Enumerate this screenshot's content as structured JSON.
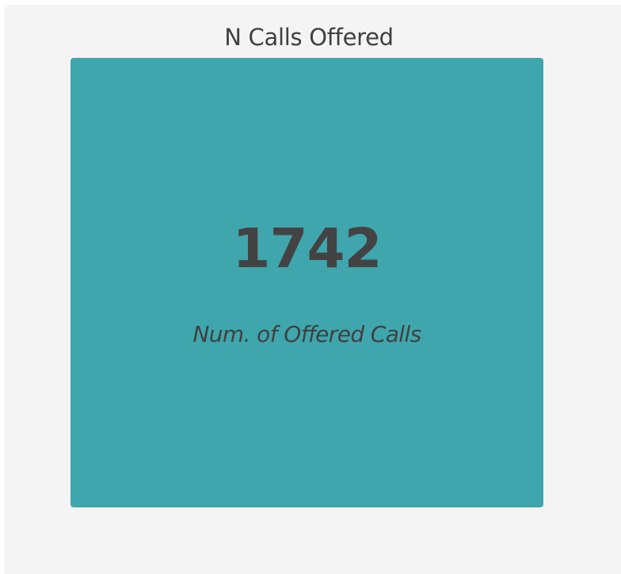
{
  "widget": {
    "title": "N Calls Offered",
    "value": "1742",
    "label": "Num. of Offered Calls",
    "card_color": "#3fa6ad"
  }
}
